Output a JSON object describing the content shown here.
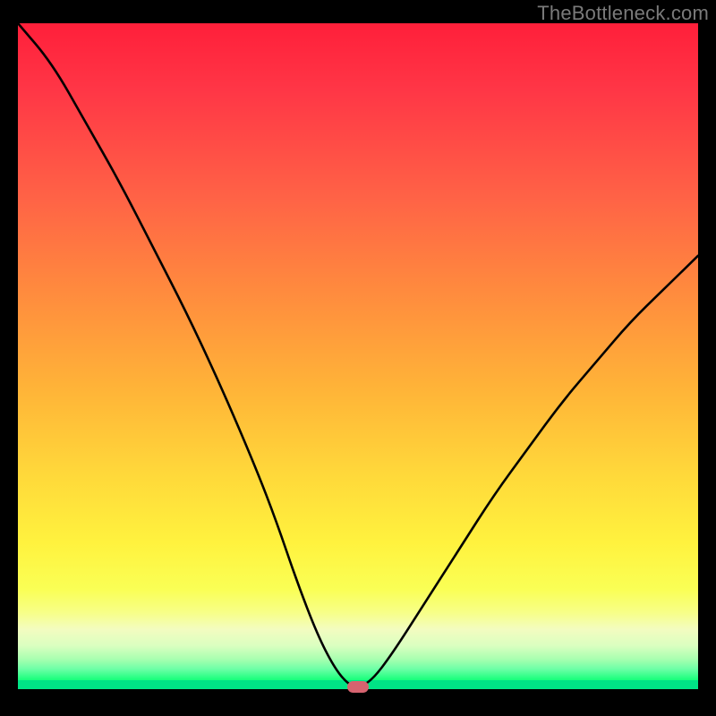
{
  "watermark": "TheBottleneck.com",
  "colors": {
    "frame_bg": "#000000",
    "curve": "#000000",
    "marker": "#d6636f",
    "gradient_top": "#ff1f3a",
    "gradient_mid": "#ffd93a",
    "gradient_bottom": "#00e386"
  },
  "chart_data": {
    "type": "line",
    "title": "",
    "xlabel": "",
    "ylabel": "",
    "xlim": [
      0,
      100
    ],
    "ylim": [
      0,
      100
    ],
    "x": [
      0,
      5,
      10,
      15,
      20,
      25,
      30,
      35,
      38,
      41,
      44,
      46.5,
      48.5,
      50,
      52,
      55,
      60,
      65,
      70,
      75,
      80,
      85,
      90,
      95,
      100
    ],
    "values": [
      100,
      94,
      85,
      76,
      66,
      56,
      45,
      33,
      25,
      16,
      8,
      3,
      0.5,
      0,
      1,
      5,
      13,
      21,
      29,
      36,
      43,
      49,
      55,
      60,
      65
    ],
    "marker": {
      "x": 50,
      "y": 0
    },
    "note": "Axis values are unlabeled in the source image; x and y are normalized 0–100. The curve drops from top-left to a minimum near x≈50 (marker), then rises toward the right to roughly y≈65."
  }
}
